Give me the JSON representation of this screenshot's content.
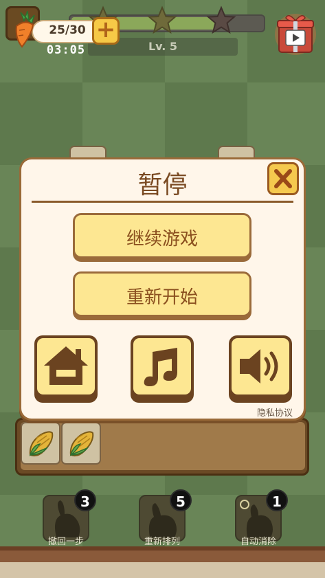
{
  "hud": {
    "counter": "25/30",
    "timer": "03:05",
    "level": "Lv. 5",
    "progress_fraction": 0.77,
    "stars_earned": 0,
    "stars_total": 3
  },
  "dialog": {
    "title": "暂停",
    "continue_label": "继续游戏",
    "restart_label": "重新开始",
    "privacy_label": "隐私协议"
  },
  "tools": [
    {
      "label": "撤回一步",
      "count": "3"
    },
    {
      "label": "重新排列",
      "count": "5"
    },
    {
      "label": "自动消除",
      "count": "1"
    }
  ],
  "colors": {
    "accent_yellow": "#fde792",
    "brown": "#7a4a22",
    "panel": "#fff6ea"
  }
}
